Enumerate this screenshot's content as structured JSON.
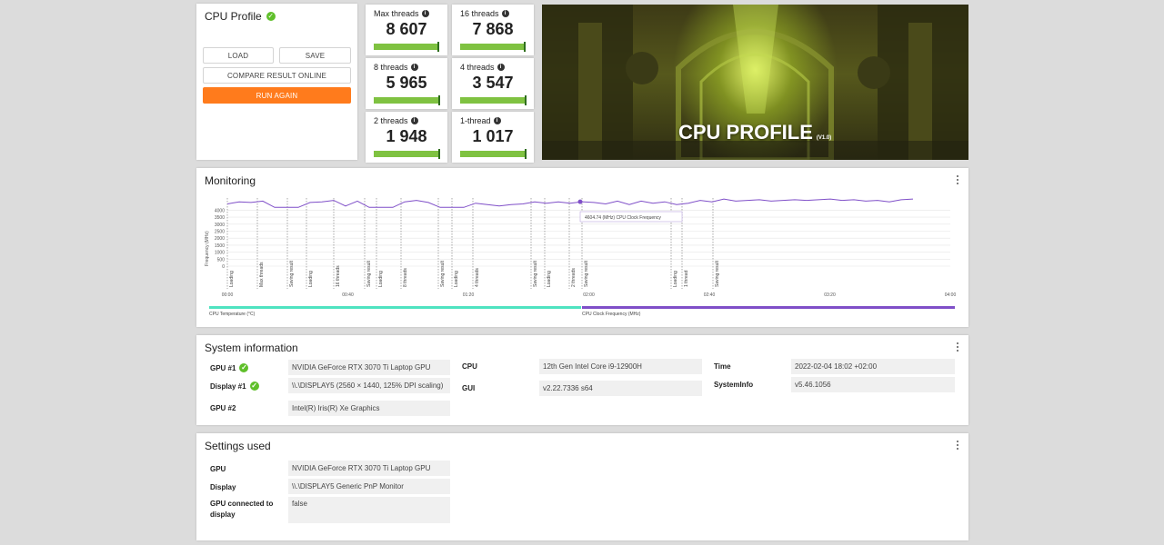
{
  "profile": {
    "title": "CPU Profile",
    "load": "LOAD",
    "save": "SAVE",
    "compare": "COMPARE RESULT ONLINE",
    "run_again": "RUN AGAIN"
  },
  "scores": [
    {
      "label": "Max threads",
      "value": "8 607",
      "bar_fill": 0.97,
      "marker": 0.97
    },
    {
      "label": "16 threads",
      "value": "7 868",
      "bar_fill": 0.97,
      "marker": 0.97
    },
    {
      "label": "8 threads",
      "value": "5 965",
      "bar_fill": 0.98,
      "marker": 0.98
    },
    {
      "label": "4 threads",
      "value": "3 547",
      "bar_fill": 0.98,
      "marker": 0.98
    },
    {
      "label": "2 threads",
      "value": "1 948",
      "bar_fill": 0.98,
      "marker": 0.98
    },
    {
      "label": "1-thread",
      "value": "1 017",
      "bar_fill": 0.98,
      "marker": 0.98
    }
  ],
  "hero": {
    "title": "CPU PROFILE",
    "version": "(V1.0)"
  },
  "monitoring": {
    "title": "Monitoring",
    "y_axis_label": "Frequency (MHz)",
    "y_ticks": [
      "4000",
      "3500",
      "3000",
      "2500",
      "2000",
      "1500",
      "1000",
      "500",
      "0"
    ],
    "x_ticks": [
      "00:00",
      "00:40",
      "01:20",
      "02:00",
      "02:40",
      "03:20",
      "04:00"
    ],
    "markers": [
      "Loading",
      "Max threads",
      "Saving result",
      "Loading",
      "16 threads",
      "Saving result",
      "Loading",
      "8 threads",
      "Saving result",
      "Loading",
      "4 threads",
      "Saving result",
      "Loading",
      "2 threads",
      "Saving result",
      "Loading",
      "1 thread",
      "Saving result"
    ],
    "tooltip": "4604.74 (MHz) CPU Clock Frequency",
    "legend": {
      "temperature": "CPU Temperature (°C)",
      "clock": "CPU Clock Frequency (MHz)"
    },
    "colors": {
      "temperature": "#4fe3c0",
      "clock": "#7f4fc8"
    }
  },
  "chart_data": {
    "type": "line",
    "title": "",
    "xlabel": "",
    "ylabel": "Frequency (MHz)",
    "x_ticks": [
      "00:00",
      "00:40",
      "01:20",
      "02:00",
      "02:40",
      "03:20",
      "04:00"
    ],
    "ylim": [
      0,
      5000
    ],
    "series": [
      {
        "name": "CPU Clock Frequency (MHz)",
        "values": [
          4450,
          4600,
          4550,
          4650,
          4200,
          4200,
          4200,
          4550,
          4600,
          4700,
          4300,
          4650,
          4200,
          4200,
          4200,
          4600,
          4700,
          4550,
          4200,
          4200,
          4200,
          4500,
          4400,
          4300,
          4400,
          4450,
          4600,
          4500,
          4600,
          4500,
          4604,
          4550,
          4450,
          4650,
          4400,
          4650,
          4500,
          4600,
          4400,
          4500,
          4700,
          4600,
          4800,
          4650,
          4700,
          4750,
          4650,
          4700,
          4750,
          4700,
          4750,
          4800,
          4700,
          4750,
          4650,
          4700,
          4600,
          4750,
          4800
        ]
      },
      {
        "name": "CPU Temperature (°C)",
        "values": []
      }
    ]
  },
  "system_info": {
    "title": "System information",
    "rows": [
      {
        "key": "GPU #1",
        "value": "NVIDIA GeForce RTX 3070 Ti Laptop GPU"
      },
      {
        "key": "Display #1",
        "value": "\\\\.\\DISPLAY5 (2560 × 1440, 125% DPI scaling)"
      },
      {
        "key": "GPU #2",
        "value": "Intel(R) Iris(R) Xe Graphics"
      },
      {
        "key": "CPU",
        "value": "12th Gen Intel Core i9-12900H"
      },
      {
        "key": "GUI",
        "value": "v2.22.7336 s64"
      },
      {
        "key": "Time",
        "value": "2022-02-04 18:02 +02:00"
      },
      {
        "key": "SystemInfo",
        "value": "v5.46.1056"
      }
    ]
  },
  "settings": {
    "title": "Settings used",
    "rows": [
      {
        "key": "GPU",
        "value": "NVIDIA GeForce RTX 3070 Ti Laptop GPU"
      },
      {
        "key": "Display",
        "value": "\\\\.\\DISPLAY5 Generic PnP Monitor"
      },
      {
        "key": "GPU connected to display",
        "value": "false"
      }
    ]
  }
}
